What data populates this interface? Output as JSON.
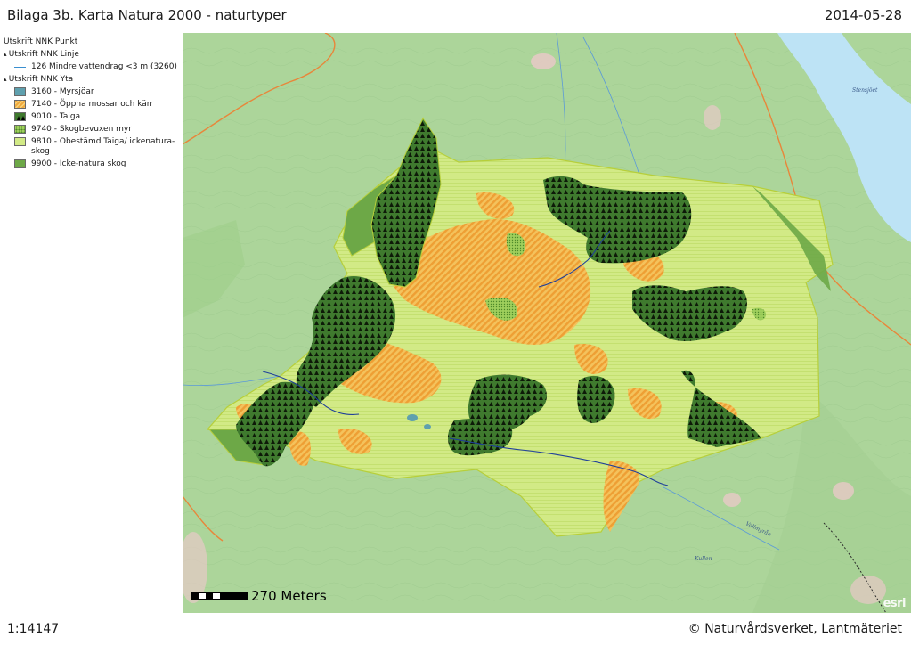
{
  "header": {
    "title": "Bilaga 3b. Karta Natura 2000 - naturtyper",
    "date": "2014-05-28"
  },
  "legend": {
    "point_layer": "Utskrift NNK Punkt",
    "line_layer": "Utskrift NNK Linje",
    "line_item": "126 Mindre vattendrag <3 m (3260)",
    "area_layer": "Utskrift NNK Yta",
    "items": [
      {
        "label": "3160 - Myrsjöar",
        "color": "#5fa0ae"
      },
      {
        "label": "7140 - Öppna mossar och kärr",
        "color": "#f0a93e"
      },
      {
        "label": "9010 - Taiga",
        "color": "#3f7a2e"
      },
      {
        "label": "9740 - Skogbevuxen myr",
        "color": "#79b443"
      },
      {
        "label": "9810 - Obestämd Taiga/ ickenatura-skog",
        "color": "#d2ea86"
      },
      {
        "label": "9900 - Icke-natura skog",
        "color": "#6da847"
      }
    ]
  },
  "map": {
    "labels": [
      "Stensjöet",
      "Vallmyrån",
      "Kullen"
    ],
    "scale_text": "270 Meters",
    "logo": "esri",
    "colors": {
      "background": "#acd59a",
      "water": "#bde3f5",
      "stream": "#2a66c2",
      "road": "#e8863a"
    }
  },
  "footer": {
    "scale": "1:14147",
    "copyright": "© Naturvårdsverket, Lantmäteriet"
  }
}
